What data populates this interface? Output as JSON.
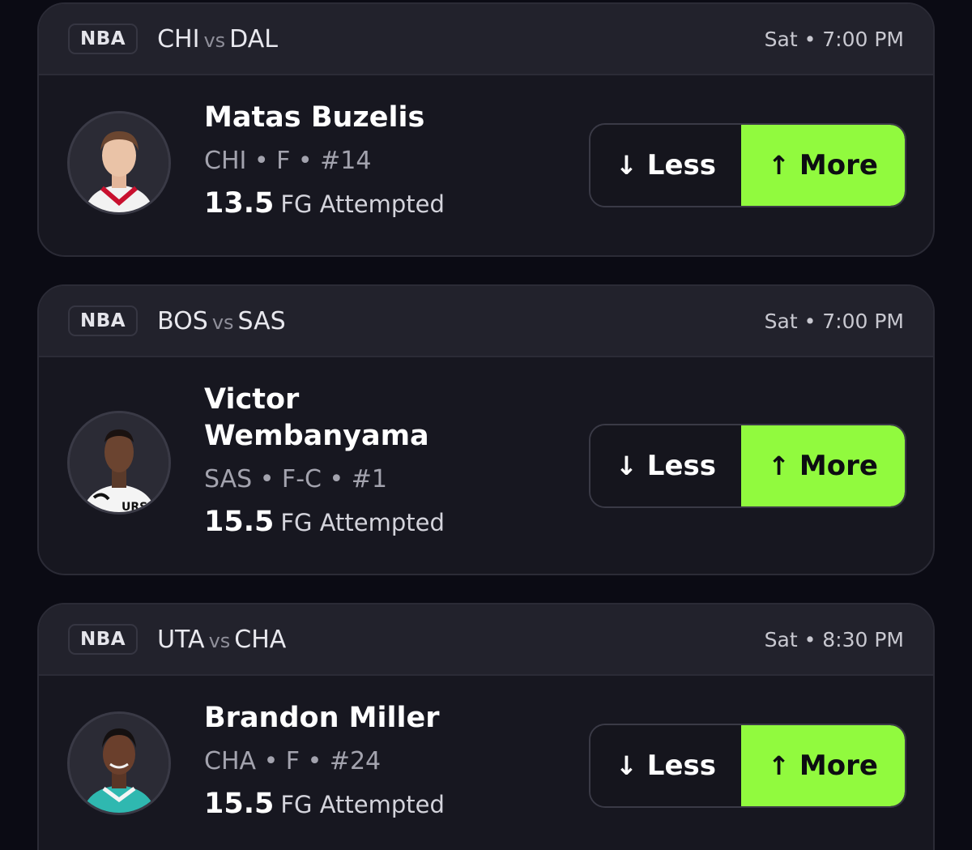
{
  "colors": {
    "background": "#0b0b14",
    "card": "#171720",
    "card_header": "#22222c",
    "more_button": "#91fa3e"
  },
  "cards": [
    {
      "league": "NBA",
      "home_team": "CHI",
      "vs": "vs",
      "away_team": "DAL",
      "time": "Sat • 7:00 PM",
      "player_name": "Matas Buzelis",
      "meta": "CHI • F • #14",
      "line": "13.5",
      "stat": "FG Attempted",
      "less_label": "Less",
      "more_label": "More",
      "less_icon": "arrow-down-icon",
      "more_icon": "arrow-up-icon"
    },
    {
      "league": "NBA",
      "home_team": "BOS",
      "vs": "vs",
      "away_team": "SAS",
      "time": "Sat • 7:00 PM",
      "player_name_line1": "Victor",
      "player_name_line2": "Wembanyama",
      "meta": "SAS • F-C • #1",
      "line": "15.5",
      "stat": "FG Attempted",
      "less_label": "Less",
      "more_label": "More",
      "less_icon": "arrow-down-icon",
      "more_icon": "arrow-up-icon"
    },
    {
      "league": "NBA",
      "home_team": "UTA",
      "vs": "vs",
      "away_team": "CHA",
      "time": "Sat • 8:30 PM",
      "player_name": "Brandon Miller",
      "meta": "CHA • F • #24",
      "line": "15.5",
      "stat": "FG Attempted",
      "less_label": "Less",
      "more_label": "More",
      "less_icon": "arrow-down-icon",
      "more_icon": "arrow-up-icon"
    }
  ]
}
